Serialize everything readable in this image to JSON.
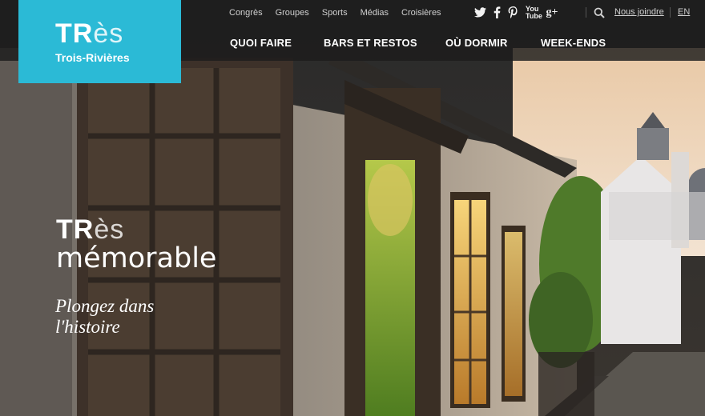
{
  "brand": {
    "logo_tres_main": "TR",
    "logo_tres_tail": "ès",
    "logo_city": "Trois-Rivières",
    "accent_color": "#2bbad6"
  },
  "utility_nav": {
    "links": [
      "Congrès",
      "Groupes",
      "Sports",
      "Médias",
      "Croisières"
    ],
    "social_icons": [
      "twitter-icon",
      "facebook-icon",
      "pinterest-icon",
      "youtube-icon",
      "google-plus-icon"
    ],
    "search_icon": "search-icon",
    "join_label": "Nous joindre",
    "language_label": "EN"
  },
  "main_nav": {
    "items": [
      "QUOI FAIRE",
      "BARS ET RESTOS",
      "OÙ DORMIR",
      "WEEK-ENDS"
    ]
  },
  "hero": {
    "tres_main": "TR",
    "tres_tail": "ès",
    "word": "mémorable",
    "tagline": "Plongez dans l'histoire"
  }
}
